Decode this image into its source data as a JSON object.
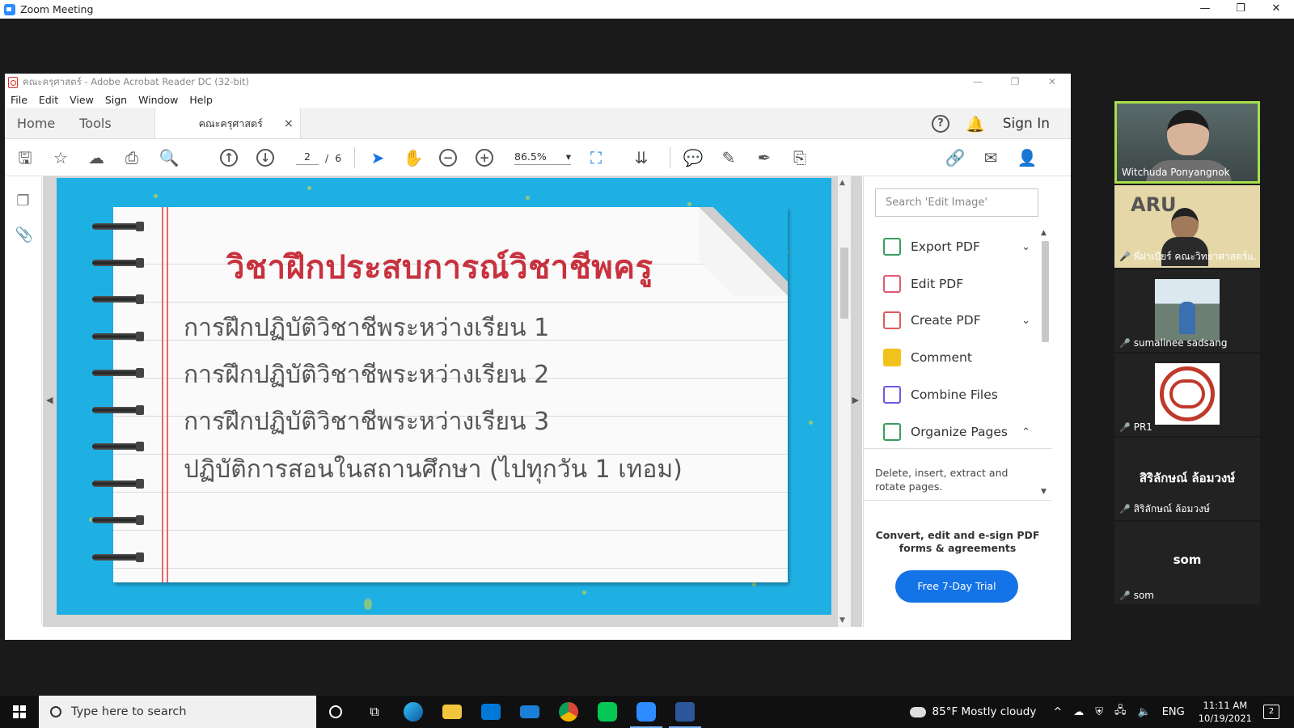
{
  "zoom": {
    "title": "Zoom Meeting",
    "controls": [
      "—",
      "❐",
      "✕"
    ]
  },
  "acrobat": {
    "title": "คณะครุศาสตร์ - Adobe Acrobat Reader DC (32-bit)",
    "window_controls": [
      "—",
      "❐",
      "✕"
    ],
    "menu": [
      "File",
      "Edit",
      "View",
      "Sign",
      "Window",
      "Help"
    ],
    "tabs": {
      "home": "Home",
      "tools": "Tools",
      "doc": "คณะครุศาสตร์",
      "close": "×"
    },
    "sign_in": "Sign In",
    "help": "?",
    "page_current": "2",
    "page_sep": "/",
    "page_total": "6",
    "zoom_level": "86.5%",
    "search_placeholder": "Search 'Edit Image'",
    "tools": [
      {
        "label": "Export PDF",
        "color": "#3a9d5d",
        "chevron": "⌄"
      },
      {
        "label": "Edit PDF",
        "color": "#e05a72",
        "chevron": ""
      },
      {
        "label": "Create PDF",
        "color": "#e05a5a",
        "chevron": "⌄"
      },
      {
        "label": "Comment",
        "color": "#f1c21b",
        "chevron": ""
      },
      {
        "label": "Combine Files",
        "color": "#6e5ae0",
        "chevron": ""
      },
      {
        "label": "Organize Pages",
        "color": "#3a9d5d",
        "chevron": "⌃"
      }
    ],
    "tools_desc": "Delete, insert, extract and rotate pages.",
    "promo": "Convert, edit and e-sign PDF forms & agreements",
    "trial_button": "Free 7-Day Trial"
  },
  "slide": {
    "title": "วิชาฝึกประสบการณ์วิชาชีพครู",
    "lines": [
      "การฝึกปฏิบัติวิชาชีพระหว่างเรียน 1",
      "การฝึกปฏิบัติวิชาชีพระหว่างเรียน 2",
      "การฝึกปฏิบัติวิชาชีพระหว่างเรียน 3",
      "ปฏิบัติการสอนในสถานศึกษา  (ไปทุกวัน  1 เทอม)"
    ]
  },
  "participants": [
    {
      "name": "Witchuda Ponyangnok",
      "muted": false,
      "active": true,
      "kind": "video"
    },
    {
      "name": "พี่ฝาเบียร์ คณะวิทยาศาสตร์แ...",
      "muted": true,
      "active": false,
      "kind": "aru",
      "overlay": "ARU"
    },
    {
      "name": "sumalinee sadsang",
      "muted": true,
      "active": false,
      "kind": "photo"
    },
    {
      "name": "PR1",
      "muted": true,
      "active": false,
      "kind": "logo"
    },
    {
      "name": "สิริลักษณ์ ล้อมวงษ์",
      "muted": true,
      "active": false,
      "kind": "text",
      "display": "สิริลักษณ์ ล้อมวงษ์"
    },
    {
      "name": "som",
      "muted": true,
      "active": false,
      "kind": "text",
      "display": "som"
    }
  ],
  "taskbar": {
    "search_placeholder": "Type here to search",
    "weather": "85°F  Mostly cloudy",
    "lang": "ENG",
    "time": "11:11 AM",
    "date": "10/19/2021",
    "notifications": "2"
  }
}
